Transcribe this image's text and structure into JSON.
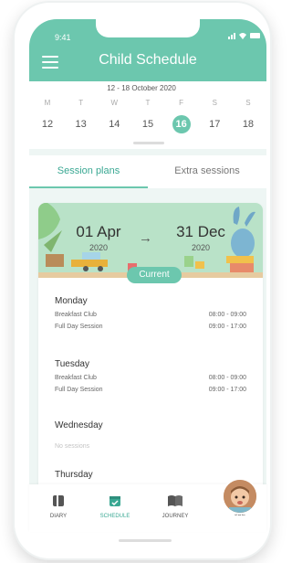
{
  "status": {
    "time": "9:41",
    "signal_icon": "signal-icon",
    "wifi_icon": "wifi-icon",
    "battery_icon": "battery-icon"
  },
  "header": {
    "title": "Child Schedule",
    "menu_icon": "menu-icon"
  },
  "week": {
    "range": "12 - 18 October 2020",
    "weekdays": [
      "M",
      "T",
      "W",
      "T",
      "F",
      "S",
      "S"
    ],
    "dates": [
      "12",
      "13",
      "14",
      "15",
      "16",
      "17",
      "18"
    ],
    "selected": "16"
  },
  "tabs": [
    {
      "label": "Session plans",
      "active": true
    },
    {
      "label": "Extra sessions",
      "active": false
    }
  ],
  "plan": {
    "from_date": "01 Apr",
    "from_year": "2020",
    "arrow": "→",
    "to_date": "31 Dec",
    "to_year": "2020",
    "status": "Current"
  },
  "days": [
    {
      "name": "Monday",
      "sessions": [
        {
          "name": "Breakfast Club",
          "time": "08:00 - 09:00"
        },
        {
          "name": "Full Day Session",
          "time": "09:00 - 17:00"
        }
      ]
    },
    {
      "name": "Tuesday",
      "sessions": [
        {
          "name": "Breakfast Club",
          "time": "08:00 - 09:00"
        },
        {
          "name": "Full Day Session",
          "time": "09:00 - 17:00"
        }
      ]
    },
    {
      "name": "Wednesday",
      "empty": "No sessions"
    },
    {
      "name": "Thursday"
    }
  ],
  "nav": {
    "items": [
      {
        "label": "DIARY",
        "icon": "diary-icon"
      },
      {
        "label": "SCHEDULE",
        "icon": "schedule-icon",
        "active": true
      },
      {
        "label": "JOURNEY",
        "icon": "journey-icon"
      },
      {
        "label": "JOE",
        "icon": "avatar"
      }
    ]
  },
  "colors": {
    "accent": "#6cc7ae",
    "accent_dark": "#3aa893",
    "banner": "#b9e2c8"
  }
}
